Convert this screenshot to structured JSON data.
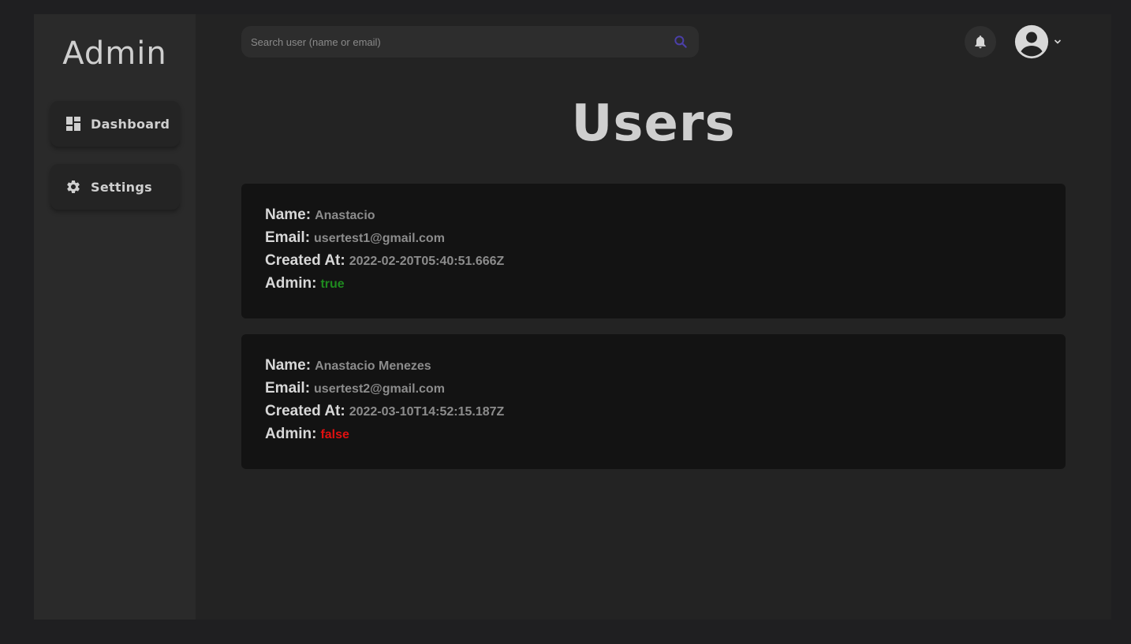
{
  "sidebar": {
    "brand": "Admin",
    "items": [
      {
        "label": "Dashboard",
        "icon": "dashboard-icon"
      },
      {
        "label": "Settings",
        "icon": "gear-icon"
      }
    ]
  },
  "header": {
    "search_placeholder": "Search user (name or email)",
    "search_value": "",
    "search_icon": "search-icon",
    "notification_icon": "bell-icon",
    "profile_icon": "account-circle-icon",
    "profile_menu_icon": "chevron-down-icon"
  },
  "main": {
    "title": "Users",
    "labels": {
      "name": "Name:",
      "email": "Email:",
      "created_at": "Created At:",
      "admin": "Admin:"
    },
    "users": [
      {
        "name": "Anastacio",
        "email": "usertest1@gmail.com",
        "created_at": "2022-02-20T05:40:51.666Z",
        "admin": "true"
      },
      {
        "name": "Anastacio Menezes",
        "email": "usertest2@gmail.com",
        "created_at": "2022-03-10T14:52:15.187Z",
        "admin": "false"
      }
    ]
  },
  "colors": {
    "admin_true": "#1f8a1f",
    "admin_false": "#e01010",
    "search_icon": "#4b3fa8",
    "card_bg": "#131313"
  }
}
